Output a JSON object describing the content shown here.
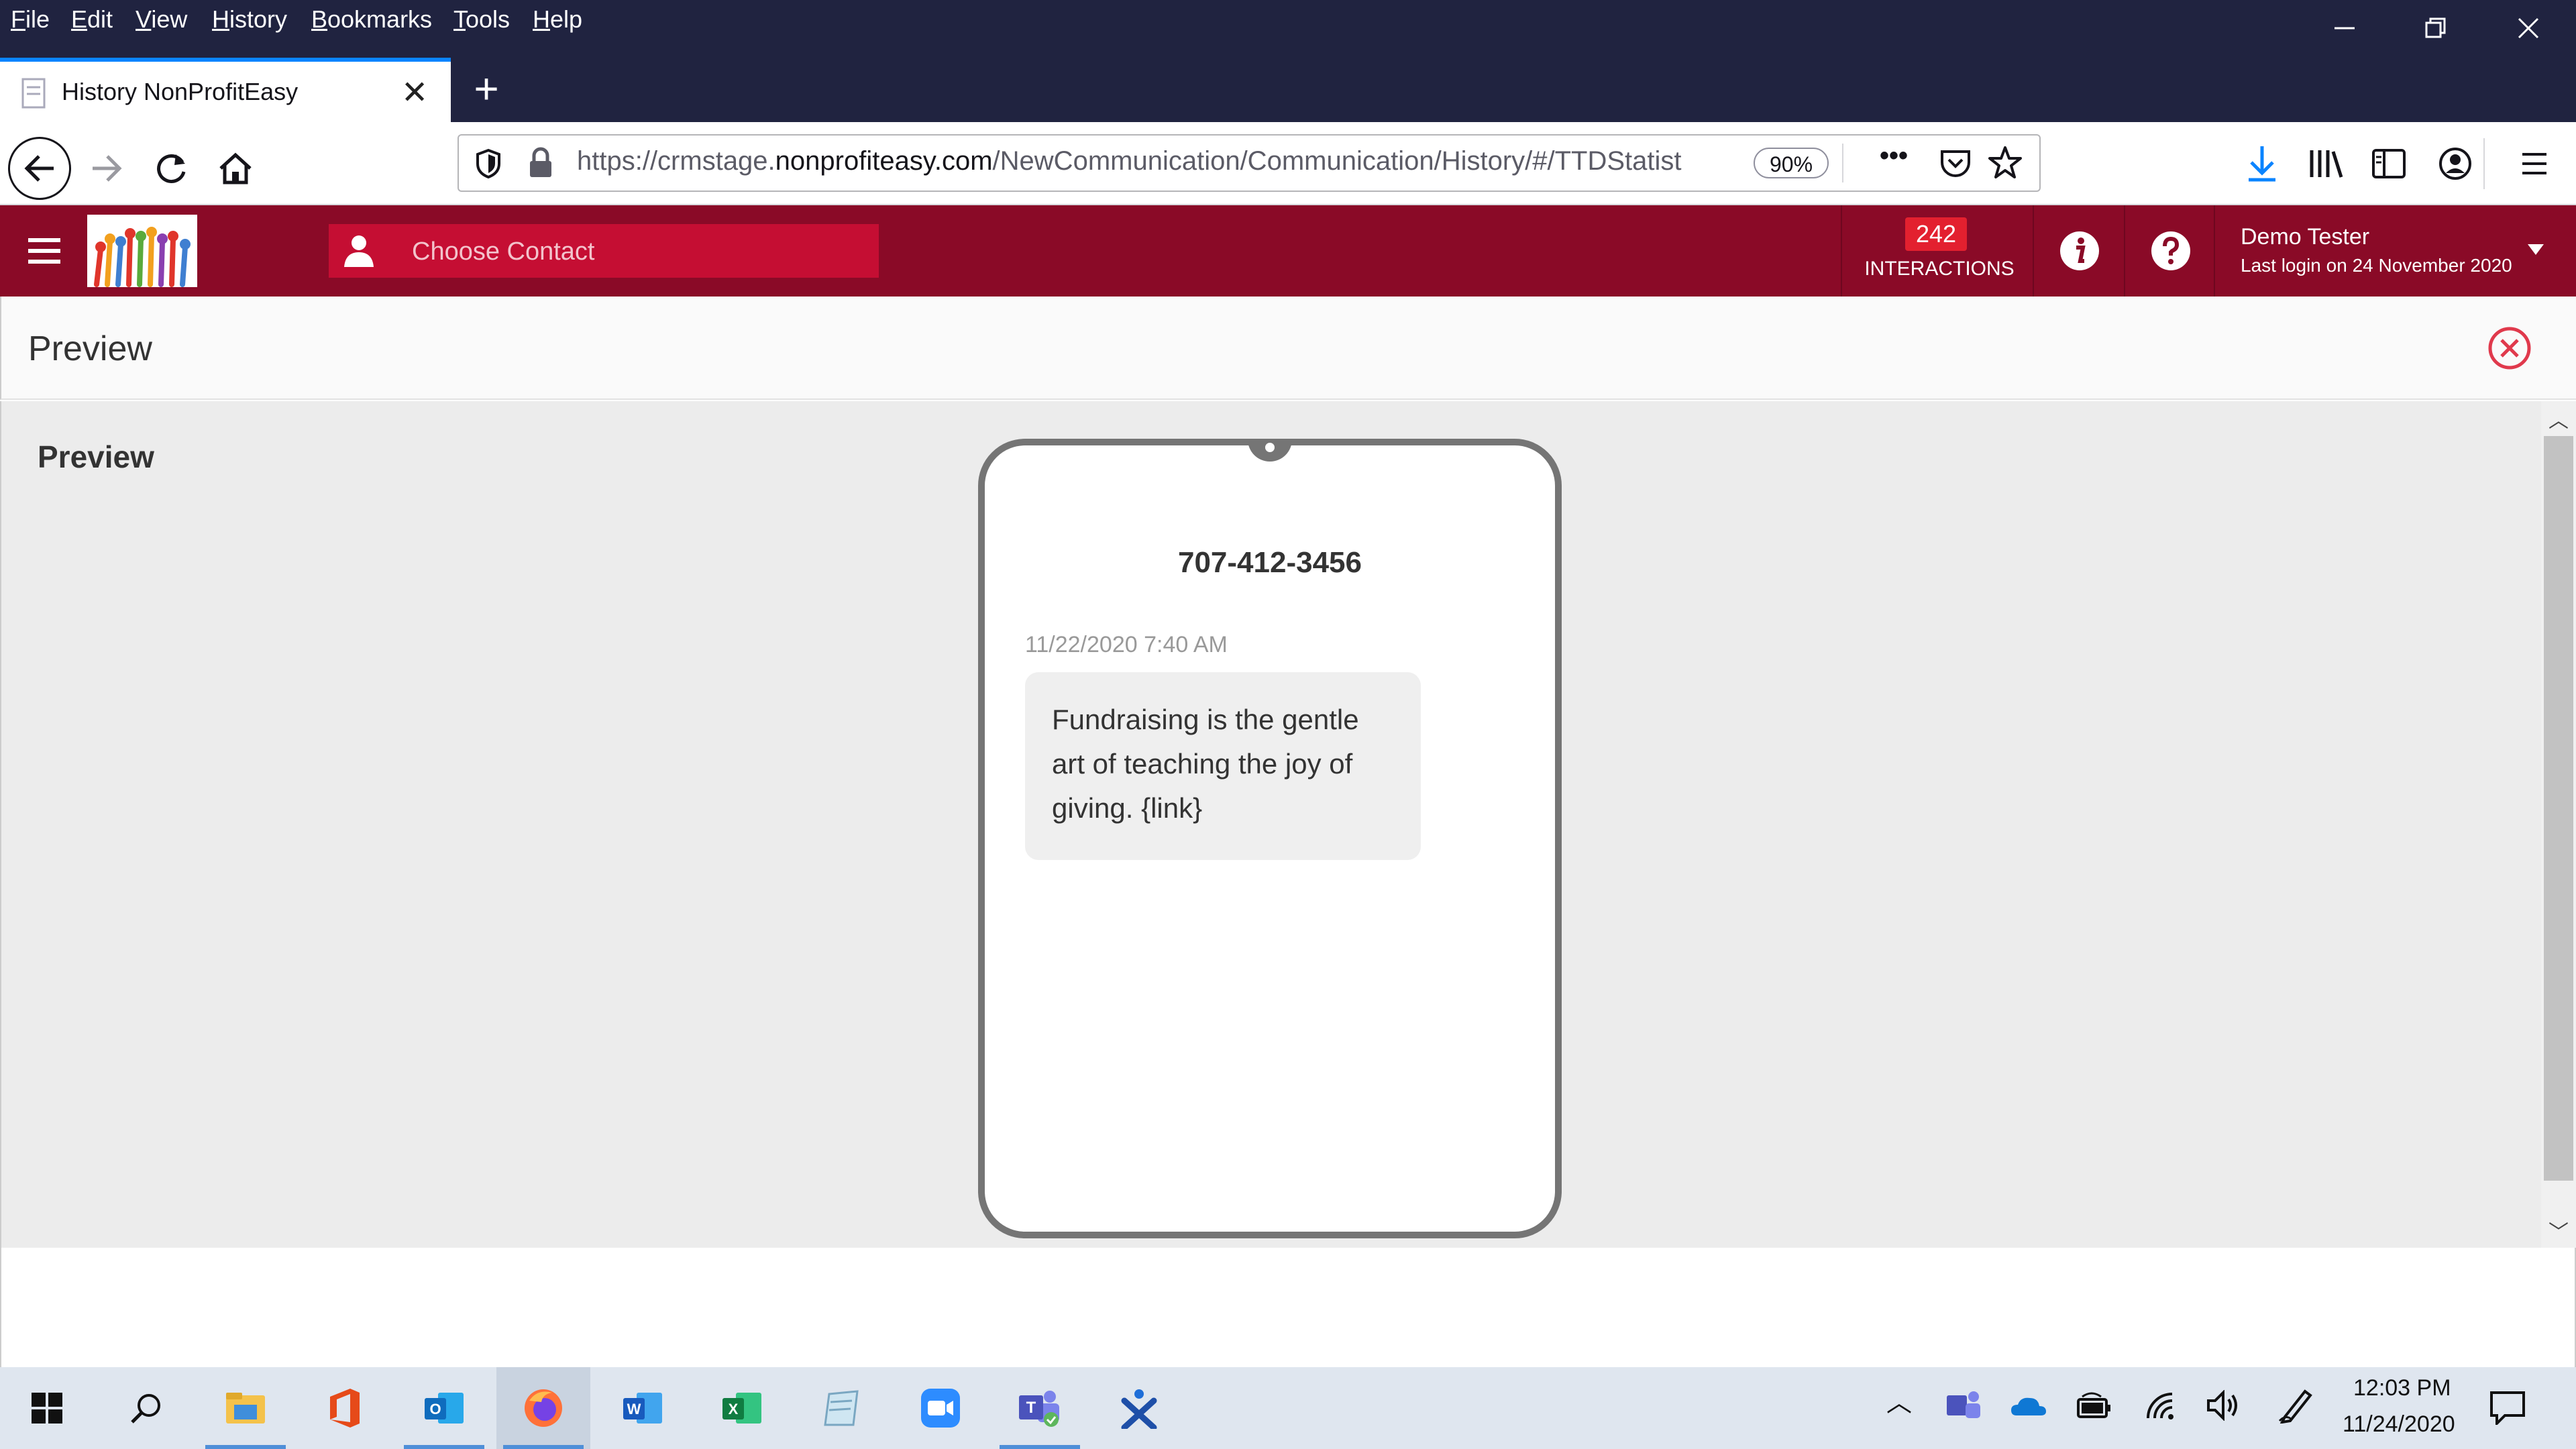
{
  "browser": {
    "menu": [
      "File",
      "Edit",
      "View",
      "History",
      "Bookmarks",
      "Tools",
      "Help"
    ],
    "tab_title": "History NonProfitEasy",
    "new_tab_label": "+",
    "url_prefix": "https://crmstage.",
    "url_domain": "nonprofiteasy.com",
    "url_path": "/NewCommunication/Communication/History/#/TTDStatist",
    "zoom": "90%",
    "page_actions": "•••"
  },
  "app": {
    "contact_placeholder": "Choose Contact",
    "interactions_count": "242",
    "interactions_label": "INTERACTIONS",
    "user_name": "Demo Tester",
    "last_login": "Last login on 24 November 2020",
    "accent_color": "#8a0a27"
  },
  "preview": {
    "panel_title": "Preview",
    "section_label": "Preview",
    "phone_number": "707-412-3456",
    "message_time": "11/22/2020 7:40 AM",
    "message_text": "Fundraising is the gentle art of teaching the joy of giving. {link}"
  },
  "taskbar": {
    "apps": [
      "start-icon",
      "search-icon",
      "file-explorer-icon",
      "office-icon",
      "outlook-icon",
      "firefox-icon",
      "word-icon",
      "excel-icon",
      "notepad-icon",
      "zoom-icon",
      "teams-icon",
      "xodo-icon"
    ],
    "time": "12:03 PM",
    "date": "11/24/2020"
  }
}
